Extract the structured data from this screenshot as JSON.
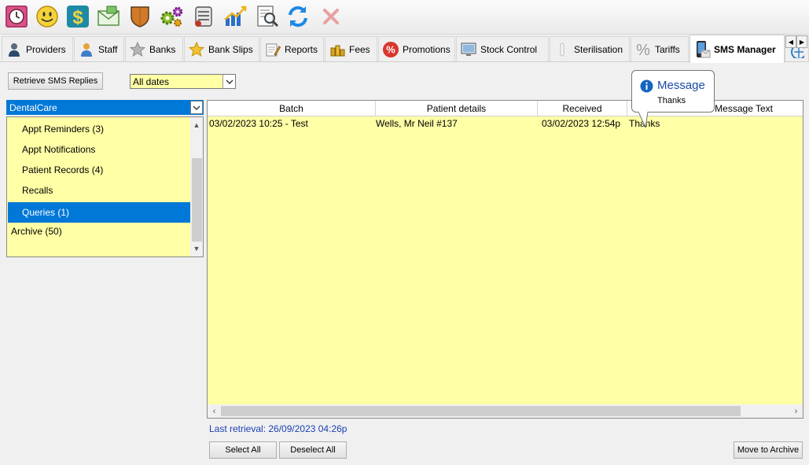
{
  "toolbar": {
    "buttons": [
      {
        "name": "appointment-book-clock-icon"
      },
      {
        "name": "patients-smiley-icon"
      },
      {
        "name": "accounts-dollar-icon"
      },
      {
        "name": "email-envelope-icon"
      },
      {
        "name": "shield-icon"
      },
      {
        "name": "settings-gears-icon"
      },
      {
        "name": "dental-chart-icon"
      },
      {
        "name": "statistics-chart-icon"
      },
      {
        "name": "search-document-icon"
      },
      {
        "name": "refresh-arrows-icon"
      },
      {
        "name": "close-x-icon"
      }
    ]
  },
  "tabs": [
    {
      "label": "Providers",
      "icon": "provider-person-icon"
    },
    {
      "label": "Staff",
      "icon": "staff-person-icon"
    },
    {
      "label": "Banks",
      "icon": "star-grey-icon"
    },
    {
      "label": "Bank Slips",
      "icon": "star-gold-icon"
    },
    {
      "label": "Reports",
      "icon": "report-pencil-icon"
    },
    {
      "label": "Fees",
      "icon": "coins-icon"
    },
    {
      "label": "Promotions",
      "icon": "percent-badge-icon"
    },
    {
      "label": "Stock Control",
      "icon": "stock-monitor-icon"
    },
    {
      "label": "Sterilisation",
      "icon": "test-tube-icon"
    },
    {
      "label": "Tariffs",
      "icon": "percent-sign-icon"
    },
    {
      "label": "SMS Manager",
      "icon": "mobile-phone-icon",
      "active": true
    }
  ],
  "controls": {
    "retrieve_button": "Retrieve SMS Replies",
    "date_filter_value": "All dates",
    "practice_value": "DentalCare"
  },
  "folders": [
    {
      "label": "Appt Reminders  (3)",
      "indent": true
    },
    {
      "label": "Appt Notifications",
      "indent": true
    },
    {
      "label": "Patient Records  (4)",
      "indent": true
    },
    {
      "label": "Recalls",
      "indent": true
    },
    {
      "label": "Queries  (1)",
      "indent": true,
      "selected": true
    },
    {
      "label": "Archive  (50)",
      "indent": false
    }
  ],
  "grid": {
    "columns": [
      "Batch",
      "Patient details",
      "Received",
      "Message Text"
    ],
    "rows": [
      {
        "batch": "03/02/2023 10:25 - Test",
        "patient": "Wells, Mr Neil #137",
        "received": "03/02/2023 12:54p",
        "message": "Thanks"
      }
    ]
  },
  "tooltip": {
    "title": "Message",
    "text": "Thanks",
    "icon": "info-icon"
  },
  "status": {
    "last_retrieval": "Last retrieval: 26/09/2023 04:26p"
  },
  "buttons": {
    "select_all": "Select All",
    "deselect_all": "Deselect All",
    "move_to_archive": "Move to Archive"
  },
  "colors": {
    "list_background": "#ffffa6",
    "selection": "#0078d7",
    "status_text": "#1a3fb5",
    "info_blue": "#1565c0"
  }
}
